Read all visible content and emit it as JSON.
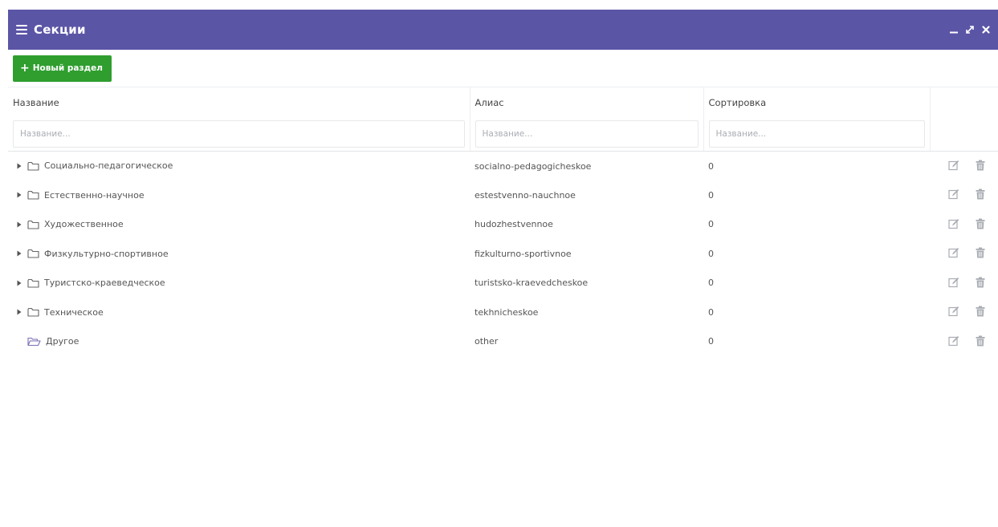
{
  "header": {
    "title": "Секции"
  },
  "toolbar": {
    "new_section_label": "Новый раздел"
  },
  "columns": {
    "name": "Название",
    "alias": "Алиас",
    "sort": "Сортировка"
  },
  "filters": {
    "name_placeholder": "Название...",
    "alias_placeholder": "Название...",
    "sort_placeholder": "Название..."
  },
  "rows": [
    {
      "name": "Социально-педагогическое",
      "alias": "socialno-pedagogicheskoe",
      "sort": "0",
      "expandable": true
    },
    {
      "name": "Естественно-научное",
      "alias": "estestvenno-nauchnoe",
      "sort": "0",
      "expandable": true
    },
    {
      "name": "Художественное",
      "alias": "hudozhestvennoe",
      "sort": "0",
      "expandable": true
    },
    {
      "name": "Физкультурно-спортивное",
      "alias": "fizkulturno-sportivnoe",
      "sort": "0",
      "expandable": true
    },
    {
      "name": "Туристско-краеведческое",
      "alias": "turistsko-kraevedcheskoe",
      "sort": "0",
      "expandable": true
    },
    {
      "name": "Техническое",
      "alias": "tekhnicheskoe",
      "sort": "0",
      "expandable": true
    },
    {
      "name": "Другое",
      "alias": "other",
      "sort": "0",
      "expandable": false
    }
  ],
  "icons": {
    "header": [
      "menu-icon",
      "minimize-icon",
      "expand-icon",
      "close-icon"
    ],
    "row": [
      "caret-right-icon",
      "folder-icon",
      "folder-open-icon",
      "edit-icon",
      "trash-icon"
    ]
  },
  "colors": {
    "header_bg": "#5b55a6",
    "button_bg": "#2f9e2f",
    "icon_gray": "#a8acb2"
  }
}
